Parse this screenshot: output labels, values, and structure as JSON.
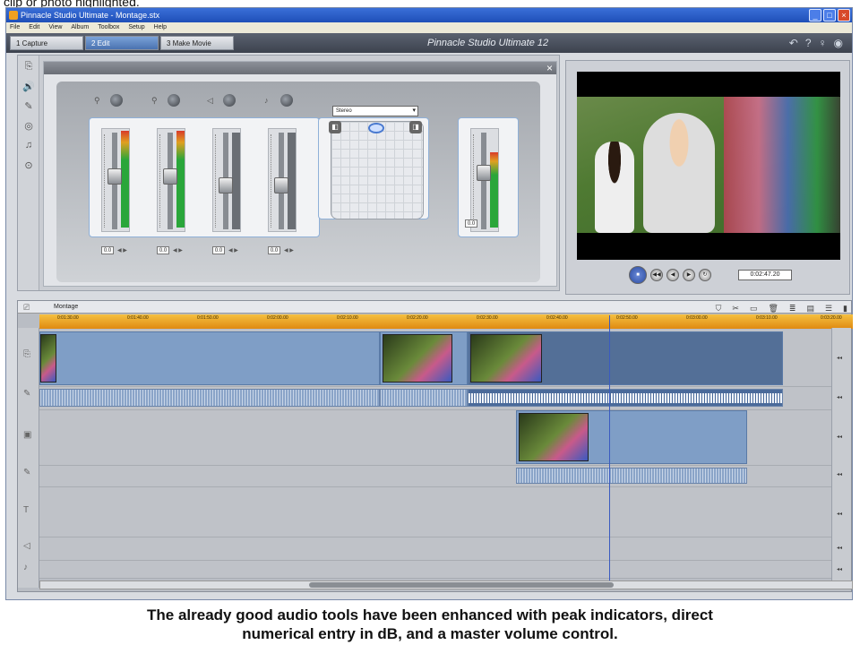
{
  "top_caption": "clip or photo highlighted.",
  "window": {
    "title": "Pinnacle Studio Ultimate - Montage.stx",
    "brand": "Pinnacle Studio Ultimate 12",
    "menu": [
      "File",
      "Edit",
      "View",
      "Album",
      "Toolbox",
      "Setup",
      "Help"
    ],
    "tabs": [
      {
        "label": "1 Capture"
      },
      {
        "label": "2 Edit"
      },
      {
        "label": "3 Make Movie"
      }
    ],
    "active_tab": "2 Edit"
  },
  "audio_mixer": {
    "pan_mode": "Stereo",
    "db_values": [
      "0.0",
      "0.0",
      "0.0",
      "0.0",
      "0.0"
    ],
    "channel_levels": [
      0.55,
      0.55,
      0.45,
      0.45,
      0.55
    ],
    "master_level": 0.6
  },
  "preview": {
    "timecode": "0:02:47.20"
  },
  "timeline": {
    "project_name": "Montage",
    "ruler_ticks": [
      "0:01:30.00",
      "0:01:40.00",
      "0:01:50.00",
      "0:02:00.00",
      "0:02:10.00",
      "0:02:20.00",
      "0:02:30.00",
      "0:02:40.00",
      "0:02:50.00",
      "0:03:00.00",
      "0:03:10.00",
      "0:03:20.00"
    ]
  },
  "bottom_caption_line1": "The already good audio tools have been enhanced with peak indicators, direct",
  "bottom_caption_line2": "numerical entry in dB, and a master volume control.",
  "colors": {
    "ruler": "#e8a020",
    "clip": "#7f9ec6",
    "accent": "#3a6fd8"
  }
}
